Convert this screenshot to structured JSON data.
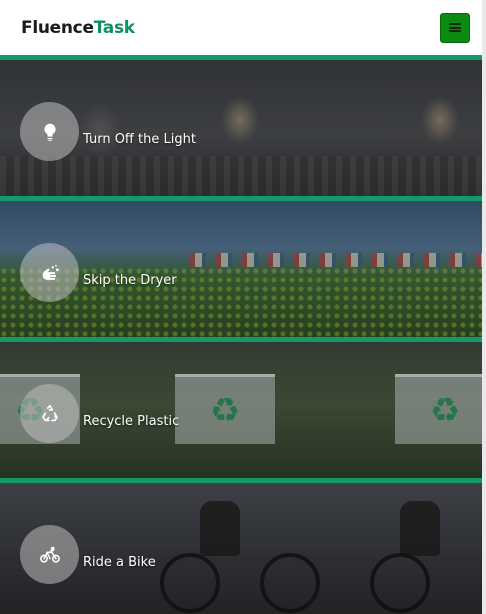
{
  "brand": {
    "part1": "Fluence",
    "part2": "Task"
  },
  "menu": {
    "icon": "hamburger-icon"
  },
  "cards": [
    {
      "label": "Turn Off the Light",
      "icon": "lightbulb-icon"
    },
    {
      "label": "Skip the Dryer",
      "icon": "hand-wash-icon"
    },
    {
      "label": "Recycle Plastic",
      "icon": "recycle-icon"
    },
    {
      "label": "Ride a Bike",
      "icon": "bicycle-icon"
    }
  ],
  "colors": {
    "accent": "#14996a",
    "brand_green": "#0f8f63",
    "menu_button": "#0b8a12"
  }
}
